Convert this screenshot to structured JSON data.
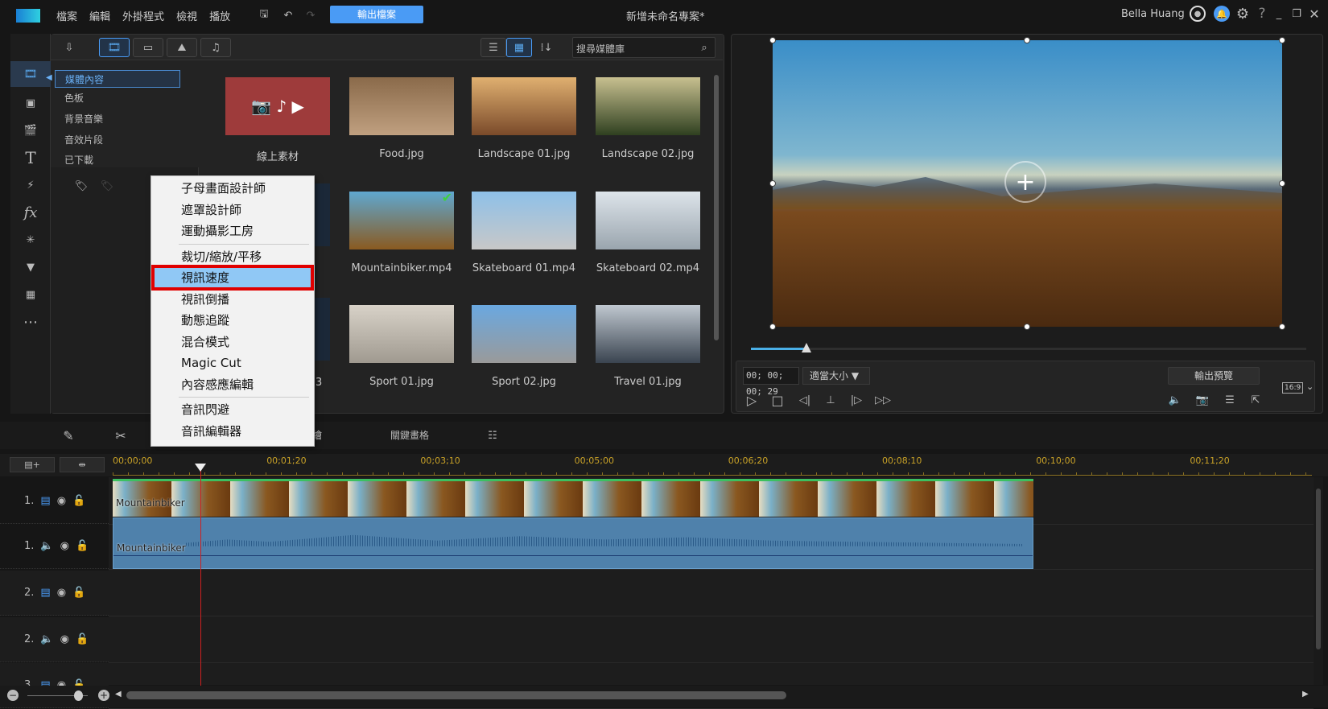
{
  "titlebar": {
    "menus": [
      "檔案",
      "編輯",
      "外掛程式",
      "檢視",
      "播放"
    ],
    "export_label": "輸出檔案",
    "project_title": "新增未命名專案*",
    "user": "Bella Huang",
    "accent": "#4a9bf5"
  },
  "library": {
    "search_placeholder": "搜尋媒體庫",
    "categories": [
      "媒體內容",
      "色板",
      "背景音樂",
      "音效片段",
      "已下載"
    ],
    "items": [
      {
        "label": "線上素材",
        "colors": [
          "#9e3b3b",
          "#9e3b3b"
        ]
      },
      {
        "label": "Food.jpg",
        "colors": [
          "#8a6a4a",
          "#c0a080"
        ]
      },
      {
        "label": "Landscape 01.jpg",
        "colors": [
          "#e0b070",
          "#7a4a2a"
        ]
      },
      {
        "label": "Landscape 02.jpg",
        "colors": [
          "#c8c090",
          "#2f4020"
        ]
      },
      {
        "label": "Mountainbiker.mp4",
        "colors": [
          "#5fa8d0",
          "#8a5a20"
        ],
        "checked": true
      },
      {
        "label": "Skateboard 01.mp4",
        "colors": [
          "#8ec0e8",
          "#c8c8c8"
        ]
      },
      {
        "label": "Skateboard 02.mp4",
        "colors": [
          "#dde4ea",
          "#9aa5ae"
        ]
      },
      {
        "label": "Sport 01.jpg",
        "colors": [
          "#d8d2c8",
          "#a09a90"
        ]
      },
      {
        "label": "Sport 02.jpg",
        "colors": [
          "#6aa8e0",
          "#9a9a9a"
        ]
      },
      {
        "label": "Travel 01.jpg",
        "colors": [
          "#c0c8d0",
          "#3a4450"
        ]
      }
    ],
    "partial_label": "3"
  },
  "context_menu": {
    "items": [
      "子母畫面設計師",
      "遮罩設計師",
      "運動攝影工房",
      "裁切/縮放/平移",
      "視訊速度",
      "視訊倒播",
      "動態追蹤",
      "混合模式",
      "Magic Cut",
      "內容感應編輯",
      "音訊閃避",
      "音訊編輯器"
    ],
    "highlighted": "視訊速度",
    "highlight_color": "#90c8f5"
  },
  "preview": {
    "timecode": "00; 00; 00; 29",
    "fit_label": "適當大小 ▼",
    "render_label": "輸出預覽",
    "aspect": "16:9",
    "progress": 0.1
  },
  "timeline": {
    "toolbar_partial": "繪",
    "keyframe_label": "關鍵畫格",
    "ruler": [
      "00;00;00",
      "00;01;20",
      "00;03;10",
      "00;05;00",
      "00;06;20",
      "00;08;10",
      "00;10;00",
      "00;11;20"
    ],
    "tracks": [
      {
        "num": "1.",
        "type": "video"
      },
      {
        "num": "1.",
        "type": "audio"
      },
      {
        "num": "2.",
        "type": "video"
      },
      {
        "num": "2.",
        "type": "audio"
      },
      {
        "num": "3.",
        "type": "video"
      }
    ],
    "clip_video": "Mountainbiker",
    "clip_audio": "Mountainbiker"
  }
}
